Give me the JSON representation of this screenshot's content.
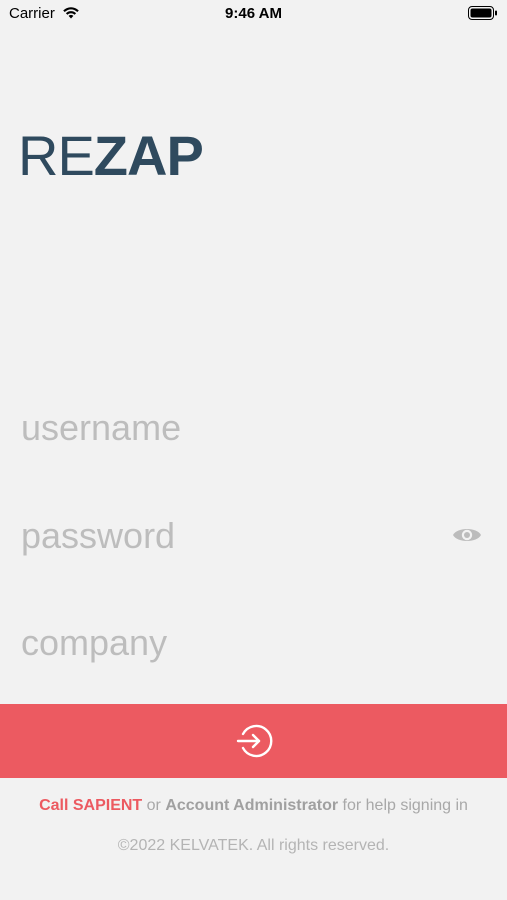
{
  "status_bar": {
    "carrier": "Carrier",
    "time": "9:46 AM",
    "icons": [
      "wifi-icon",
      "battery-icon"
    ]
  },
  "logo": {
    "part1": "RE",
    "part2": "ZAP",
    "color": "#2f4a5e"
  },
  "form": {
    "username_placeholder": "username",
    "password_placeholder": "password",
    "company_placeholder": "company",
    "password_toggle_icon": "eye-icon"
  },
  "login_button": {
    "icon": "sign-in-arrow-icon",
    "color": "#ec5a61"
  },
  "footer": {
    "call_text": "Call SAPIENT",
    "or_text": " or ",
    "admin_text": "Account Administrator",
    "help_text": " for help signing in",
    "copyright": "©2022 KELVATEK. All rights reserved."
  }
}
